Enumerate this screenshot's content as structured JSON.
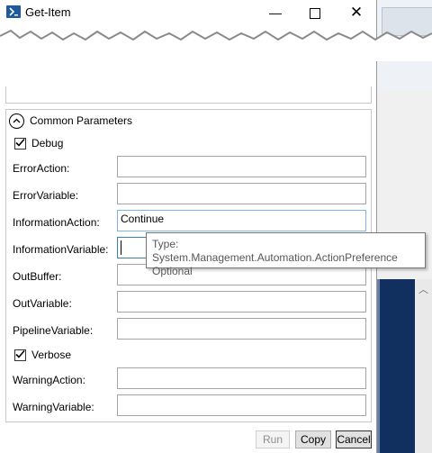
{
  "window": {
    "title": "Get-Item",
    "minimize_glyph": "—",
    "close_glyph": "✕"
  },
  "common_parameters": {
    "header": "Common Parameters",
    "debug": {
      "label": "Debug",
      "checked": true
    },
    "verbose": {
      "label": "Verbose",
      "checked": true
    },
    "fields": [
      {
        "label": "ErrorAction:",
        "value": ""
      },
      {
        "label": "ErrorVariable:",
        "value": ""
      },
      {
        "label": "InformationAction:",
        "value": "Continue"
      },
      {
        "label": "InformationVariable:",
        "value": ""
      },
      {
        "label": "OutBuffer:",
        "value": ""
      },
      {
        "label": "OutVariable:",
        "value": ""
      },
      {
        "label": "PipelineVariable:",
        "value": ""
      },
      {
        "label": "WarningAction:",
        "value": ""
      },
      {
        "label": "WarningVariable:",
        "value": ""
      }
    ]
  },
  "tooltip": {
    "line1": "Type: System.Management.Automation.ActionPreference",
    "line2": "Optional"
  },
  "buttons": {
    "run": "Run",
    "copy": "Copy",
    "cancel": "Cancel"
  },
  "colors": {
    "background_app": "#0f2a5a",
    "focus_border": "#7eb4ea"
  }
}
